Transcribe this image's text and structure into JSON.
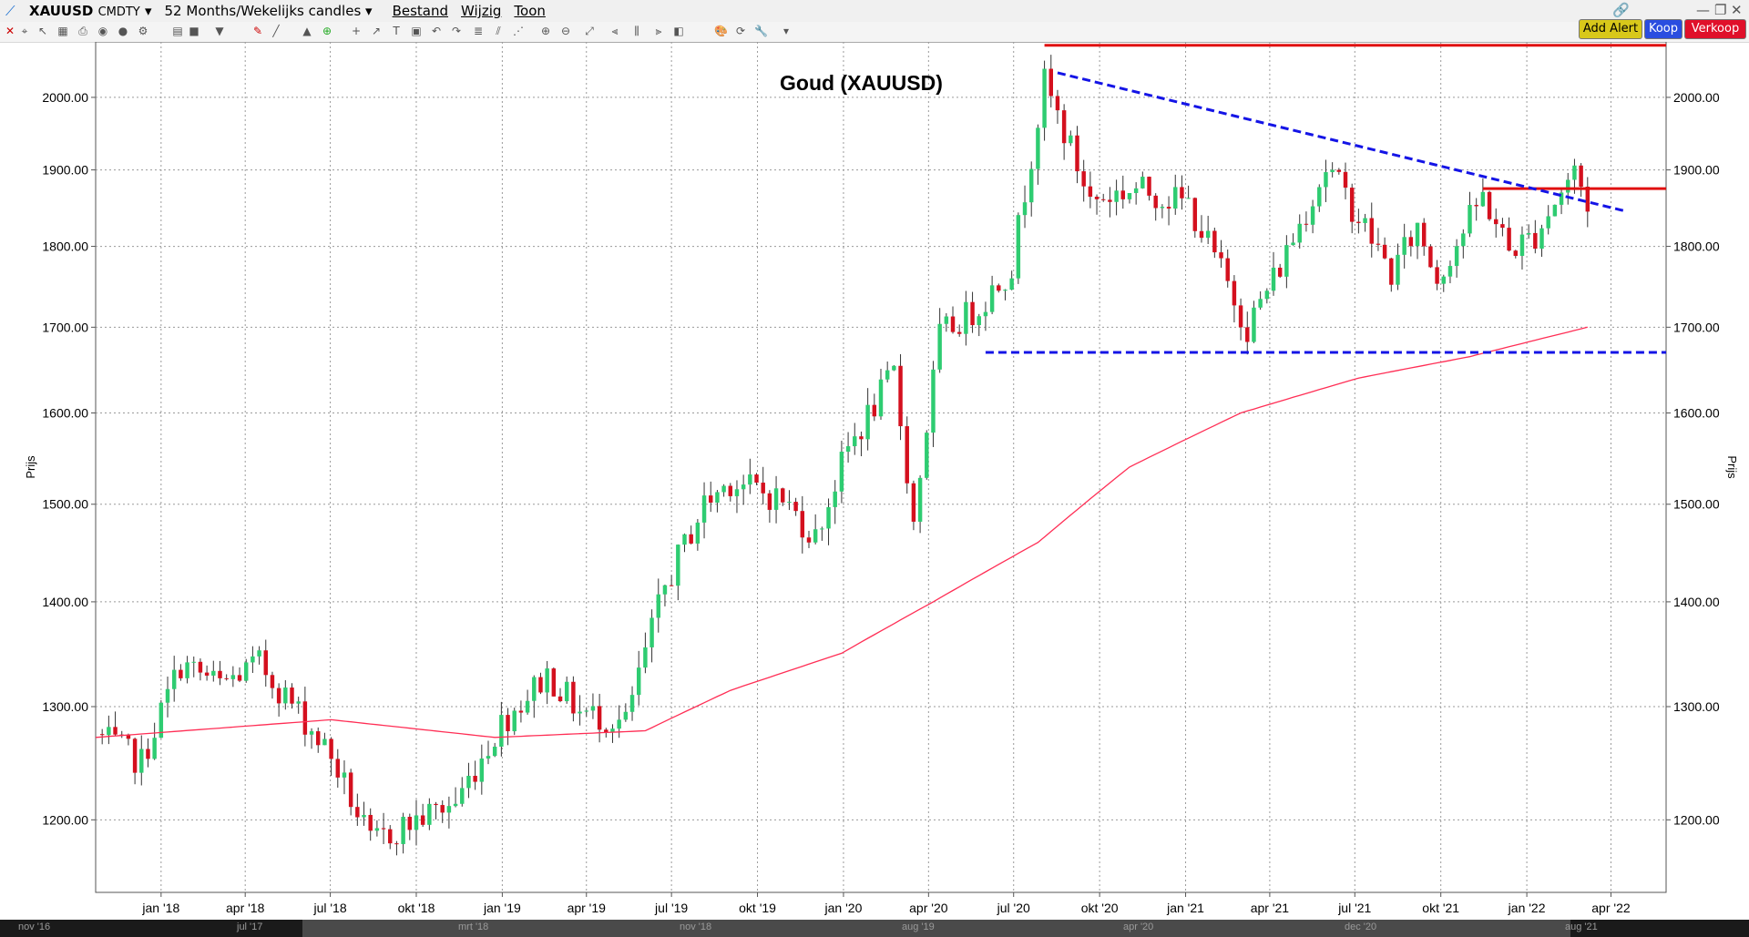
{
  "header": {
    "symbol": "XAUUSD",
    "exchange": "CMDTY",
    "period": "52 Months/Wekelijks candles",
    "menu": [
      "Bestand",
      "Wijzig",
      "Toon"
    ]
  },
  "buttons": {
    "alert": "Add Alert",
    "buy": "Koop",
    "sell": "Verkoop"
  },
  "colors": {
    "up": "#2ecc71",
    "down": "#d4101e",
    "sma": "#ff2e55",
    "hline": "#e01010",
    "trend": "#1414e6"
  },
  "chart_data": {
    "type": "candlestick",
    "title": "Goud (XAUUSD)",
    "ylabel": "Prijs",
    "ylim": [
      1140,
      2080
    ],
    "y_scale": "log",
    "y_ticks": [
      "1200.00",
      "1300.00",
      "1400.00",
      "1500.00",
      "1600.00",
      "1700.00",
      "1800.00",
      "1900.00",
      "2000.00"
    ],
    "x_ticks": [
      "jan '18",
      "apr '18",
      "jul '18",
      "okt '18",
      "jan '19",
      "apr '19",
      "jul '19",
      "okt '19",
      "jan '20",
      "apr '20",
      "jul '20",
      "okt '20",
      "jan '21",
      "apr '21",
      "jul '21",
      "okt '21",
      "jan '22",
      "apr '22"
    ],
    "x_range": [
      "2017-10-23",
      "2022-05-30"
    ],
    "grid": true,
    "anchors": [
      [
        "2017-10-23",
        1275
      ],
      [
        "2017-12-11",
        1250
      ],
      [
        "2018-01-22",
        1340
      ],
      [
        "2018-03-05",
        1320
      ],
      [
        "2018-04-16",
        1340
      ],
      [
        "2018-05-28",
        1295
      ],
      [
        "2018-07-02",
        1255
      ],
      [
        "2018-08-13",
        1180
      ],
      [
        "2018-10-01",
        1200
      ],
      [
        "2018-11-12",
        1215
      ],
      [
        "2018-12-31",
        1285
      ],
      [
        "2019-02-18",
        1330
      ],
      [
        "2019-03-25",
        1295
      ],
      [
        "2019-05-13",
        1285
      ],
      [
        "2019-06-24",
        1415
      ],
      [
        "2019-08-05",
        1500
      ],
      [
        "2019-09-02",
        1525
      ],
      [
        "2019-10-28",
        1505
      ],
      [
        "2019-12-02",
        1465
      ],
      [
        "2020-01-06",
        1560
      ],
      [
        "2020-02-24",
        1645
      ],
      [
        "2020-03-16",
        1480
      ],
      [
        "2020-04-13",
        1690
      ],
      [
        "2020-05-25",
        1725
      ],
      [
        "2020-06-29",
        1775
      ],
      [
        "2020-08-03",
        2020
      ],
      [
        "2020-09-21",
        1860
      ],
      [
        "2020-11-09",
        1875
      ],
      [
        "2021-01-04",
        1855
      ],
      [
        "2021-03-08",
        1700
      ],
      [
        "2021-04-12",
        1775
      ],
      [
        "2021-06-01",
        1905
      ],
      [
        "2021-07-19",
        1810
      ],
      [
        "2021-08-09",
        1765
      ],
      [
        "2021-09-06",
        1825
      ],
      [
        "2021-09-27",
        1760
      ],
      [
        "2021-11-15",
        1865
      ],
      [
        "2021-12-13",
        1795
      ],
      [
        "2022-01-10",
        1815
      ],
      [
        "2022-02-21",
        1900
      ],
      [
        "2022-03-07",
        1855
      ]
    ],
    "sma_anchors": [
      [
        "2017-10-23",
        1272
      ],
      [
        "2018-07-02",
        1288
      ],
      [
        "2018-12-24",
        1272
      ],
      [
        "2019-06-03",
        1278
      ],
      [
        "2019-09-02",
        1315
      ],
      [
        "2019-12-30",
        1350
      ],
      [
        "2020-04-06",
        1400
      ],
      [
        "2020-07-27",
        1460
      ],
      [
        "2020-11-02",
        1540
      ],
      [
        "2021-03-01",
        1600
      ],
      [
        "2021-07-05",
        1640
      ],
      [
        "2021-11-01",
        1665
      ],
      [
        "2022-03-07",
        1700
      ]
    ],
    "hlines": [
      {
        "y": 2075,
        "x1": "2020-08-03",
        "x2": "2022-05-30",
        "color": "#e01010",
        "dash": false
      },
      {
        "y": 1875,
        "x1": "2021-11-15",
        "x2": "2022-05-30",
        "color": "#e01010",
        "dash": false
      },
      {
        "y": 1670,
        "x1": "2020-06-01",
        "x2": "2022-05-30",
        "color": "#1414e6",
        "dash": true
      }
    ],
    "trendline": {
      "x1": "2020-08-17",
      "y1": 2035,
      "x2": "2022-04-18",
      "y2": 1845,
      "color": "#1414e6"
    }
  },
  "navigator": {
    "labels": [
      "nov '16",
      "jul '17",
      "mrt '18",
      "nov '18",
      "aug '19",
      "apr '20",
      "dec '20",
      "aug '21"
    ]
  }
}
